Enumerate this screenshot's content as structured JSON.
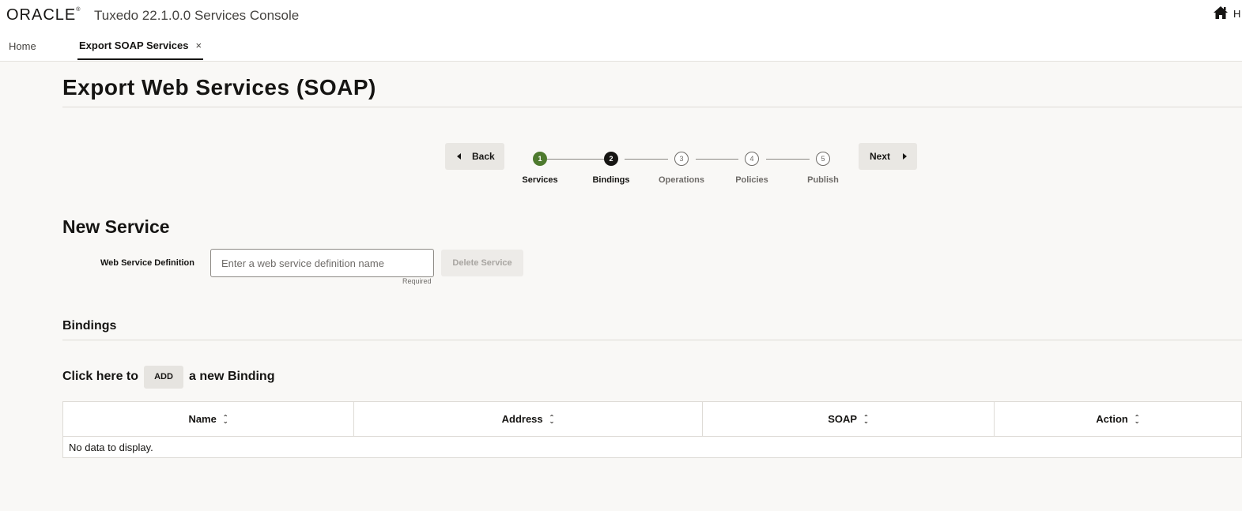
{
  "header": {
    "logo_text": "ORACLE",
    "app_title": "Tuxedo 22.1.0.0 Services Console",
    "user_initial": "H"
  },
  "tabs": [
    {
      "label": "Home"
    },
    {
      "label": "Export SOAP Services",
      "close": "×"
    }
  ],
  "page": {
    "title": "Export Web Services (SOAP)"
  },
  "wizard": {
    "back_label": "Back",
    "next_label": "Next",
    "current_step": 2,
    "steps": [
      {
        "number": "1",
        "label": "Services",
        "state": "done"
      },
      {
        "number": "2",
        "label": "Bindings",
        "state": "current"
      },
      {
        "number": "3",
        "label": "Operations",
        "state": "future"
      },
      {
        "number": "4",
        "label": "Policies",
        "state": "future"
      },
      {
        "number": "5",
        "label": "Publish",
        "state": "future"
      }
    ]
  },
  "new_service": {
    "title": "New Service",
    "field_label": "Web Service Definition",
    "placeholder": "Enter a web service definition name",
    "value": "",
    "required_text": "Required",
    "delete_label": "Delete Service"
  },
  "bindings": {
    "title": "Bindings",
    "add_prefix": "Click here to",
    "add_label": "ADD",
    "add_suffix": "a new Binding",
    "columns": [
      "Name",
      "Address",
      "SOAP",
      "Action"
    ],
    "empty_text": "No data to display."
  },
  "colors": {
    "step_done": "#4e7a2e",
    "step_current": "#161513",
    "page_bg": "#f9f8f6"
  }
}
